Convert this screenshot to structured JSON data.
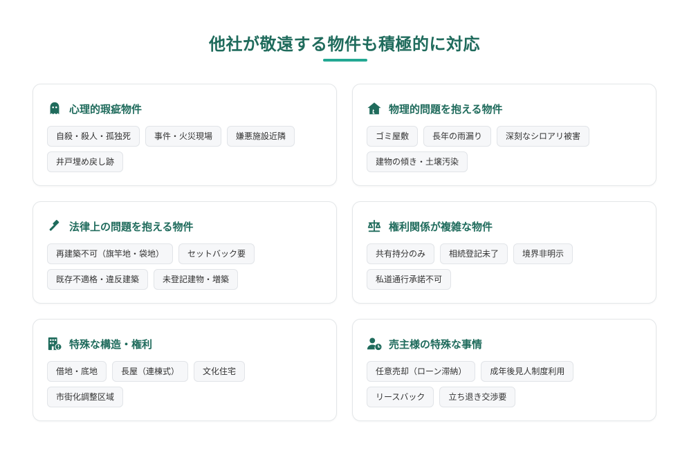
{
  "header": {
    "title": "他社が敬遠する物件も積極的に対応"
  },
  "colors": {
    "accent": "#1f6b5c",
    "underline": "#23a893",
    "tag_bg": "#f6f7f9",
    "tag_border": "#e1e4e8"
  },
  "cards": [
    {
      "icon": "ghost-icon",
      "title": "心理的瑕疵物件",
      "tags": [
        "自殺・殺人・孤独死",
        "事件・火災現場",
        "嫌悪施設近隣",
        "井戸埋め戻し跡"
      ]
    },
    {
      "icon": "house-damage-icon",
      "title": "物理的問題を抱える物件",
      "tags": [
        "ゴミ屋敷",
        "長年の雨漏り",
        "深刻なシロアリ被害",
        "建物の傾き・土壌汚染"
      ]
    },
    {
      "icon": "gavel-icon",
      "title": "法律上の問題を抱える物件",
      "tags": [
        "再建築不可（旗竿地・袋地）",
        "セットバック要",
        "既存不適格・違反建築",
        "未登記建物・増築"
      ]
    },
    {
      "icon": "scale-icon",
      "title": "権利関係が複雑な物件",
      "tags": [
        "共有持分のみ",
        "相続登記未了",
        "境界非明示",
        "私道通行承諾不可"
      ]
    },
    {
      "icon": "building-alert-icon",
      "title": "特殊な構造・権利",
      "tags": [
        "借地・底地",
        "長屋（連棟式）",
        "文化住宅",
        "市街化調整区域"
      ]
    },
    {
      "icon": "user-clock-icon",
      "title": "売主様の特殊な事情",
      "tags": [
        "任意売却（ローン滞納）",
        "成年後見人制度利用",
        "リースバック",
        "立ち退き交渉要"
      ]
    }
  ]
}
